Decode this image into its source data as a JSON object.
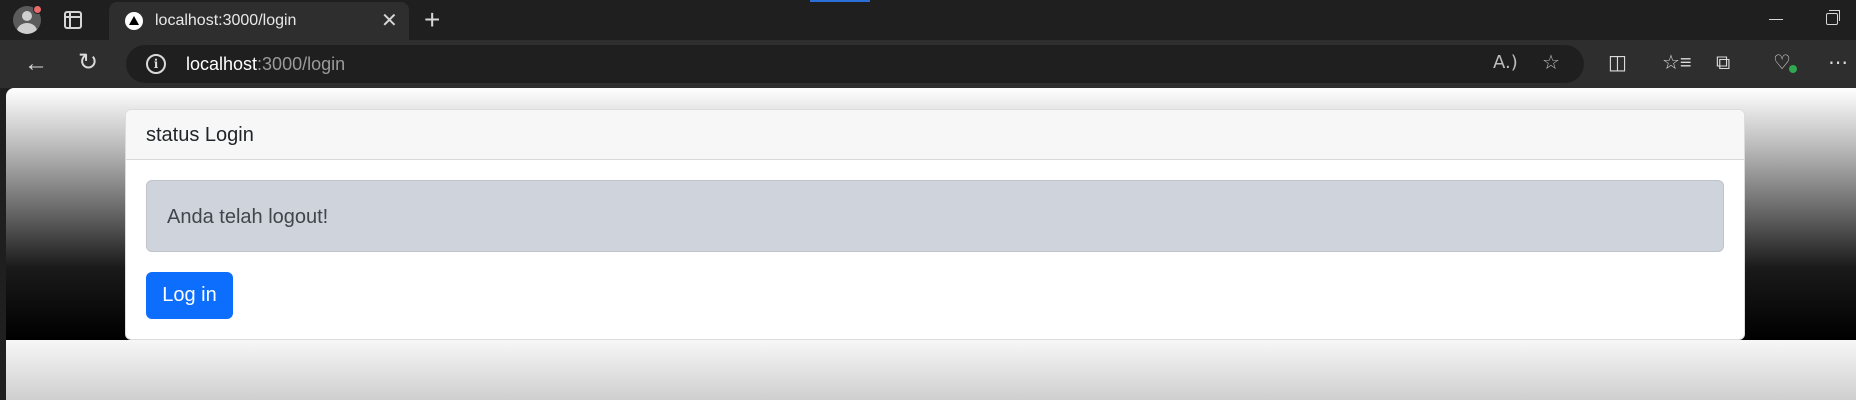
{
  "browser": {
    "tab": {
      "title": "localhost:3000/login",
      "close_glyph": "✕"
    },
    "new_tab_glyph": "+",
    "address": {
      "host": "localhost",
      "rest": ":3000/login"
    },
    "icons": {
      "back": "back-arrow-icon",
      "reload": "reload-icon",
      "info": "info-icon",
      "read_aloud": "read-aloud-icon",
      "favorite": "star-icon",
      "split_screen": "split-screen-icon",
      "favorites": "favorites-icon",
      "collections": "collections-icon",
      "browser_essentials": "heart-pulse-icon",
      "more": "more-icon"
    }
  },
  "page": {
    "card_title": "status Login",
    "alert_message": "Anda telah logout!",
    "login_button": "Log in"
  },
  "colors": {
    "primary_button": "#0d6efd",
    "alert_background": "#cfd3dc"
  }
}
